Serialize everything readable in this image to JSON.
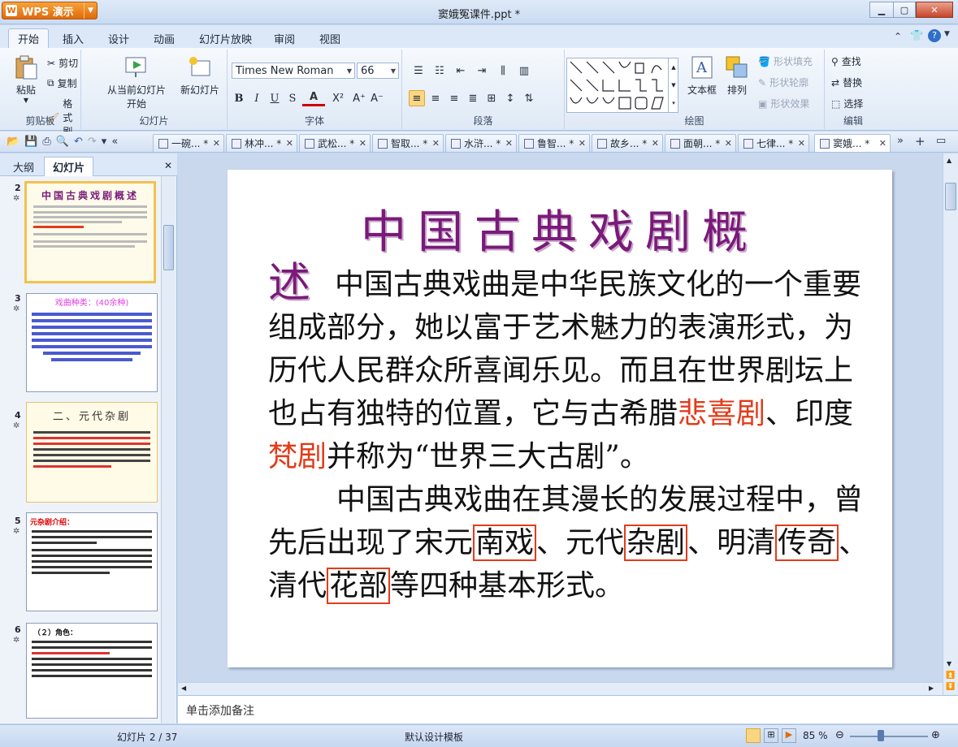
{
  "app": {
    "name": "WPS 演示",
    "doc_title": "窦娥冤课件.ppt *"
  },
  "menu": [
    "开始",
    "插入",
    "设计",
    "动画",
    "幻灯片放映",
    "审阅",
    "视图"
  ],
  "ribbon": {
    "clipboard": {
      "paste": "粘贴",
      "cut": "剪切",
      "copy": "复制",
      "format_painter": "格式刷",
      "label": "剪贴板"
    },
    "slides": {
      "from_current": "从当前幻灯片",
      "start": "开始",
      "new_slide": "新幻灯片",
      "label": "幻灯片"
    },
    "font": {
      "family": "Times New Roman",
      "size": "66",
      "label": "字体"
    },
    "paragraph": {
      "label": "段落"
    },
    "drawing": {
      "textbox": "文本框",
      "arrange": "排列",
      "shape_fill": "形状填充",
      "shape_outline": "形状轮廓",
      "shape_effect": "形状效果",
      "label": "绘图"
    },
    "editing": {
      "find": "查找",
      "replace": "替换",
      "select": "选择",
      "label": "编辑"
    }
  },
  "doc_tabs": [
    "一碗... *",
    "林冲... *",
    "武松... *",
    "智取... *",
    "水浒... *",
    "鲁智... *",
    "故乡... *",
    "面朝... *",
    "七律... *",
    "窦娥... *"
  ],
  "left_panel": {
    "tab_outline": "大纲",
    "tab_slides": "幻灯片"
  },
  "thumbnails": [
    {
      "num": "2",
      "title": "中国古典戏剧概述"
    },
    {
      "num": "3",
      "title": "戏曲种类：(40余种)"
    },
    {
      "num": "4",
      "title": "二、元代杂剧"
    },
    {
      "num": "5",
      "title": "元杂剧介绍："
    },
    {
      "num": "6",
      "title": "（２）角色："
    }
  ],
  "slide": {
    "title": "中国古典戏剧概",
    "title_end": "述",
    "p1_a": "中国古典戏曲是中华民族文化的一个重要组成部分，她以富于艺术魅力的表演形式，为历代人民群众所喜闻乐见。而且在世界剧坛上也占有独特的位置，它与古希腊",
    "p1_red1": "悲喜剧",
    "p1_b": "、印度",
    "p1_red2": "梵剧",
    "p1_c": "并称为“世界三大古剧”。",
    "p2_a": "中国古典戏曲在其漫长的发展过程中，曾先后出现了宋元",
    "p2_box1": "南戏",
    "p2_b": "、元代",
    "p2_box2": "杂剧",
    "p2_c": "、明清",
    "p2_box3": "传奇",
    "p2_d": "、清代",
    "p2_box4": "花部",
    "p2_e": "等四种基本形式。"
  },
  "notes_placeholder": "单击添加备注",
  "status": {
    "slide_pos": "幻灯片 2 / 37",
    "template": "默认设计模板",
    "zoom": "85 %"
  }
}
